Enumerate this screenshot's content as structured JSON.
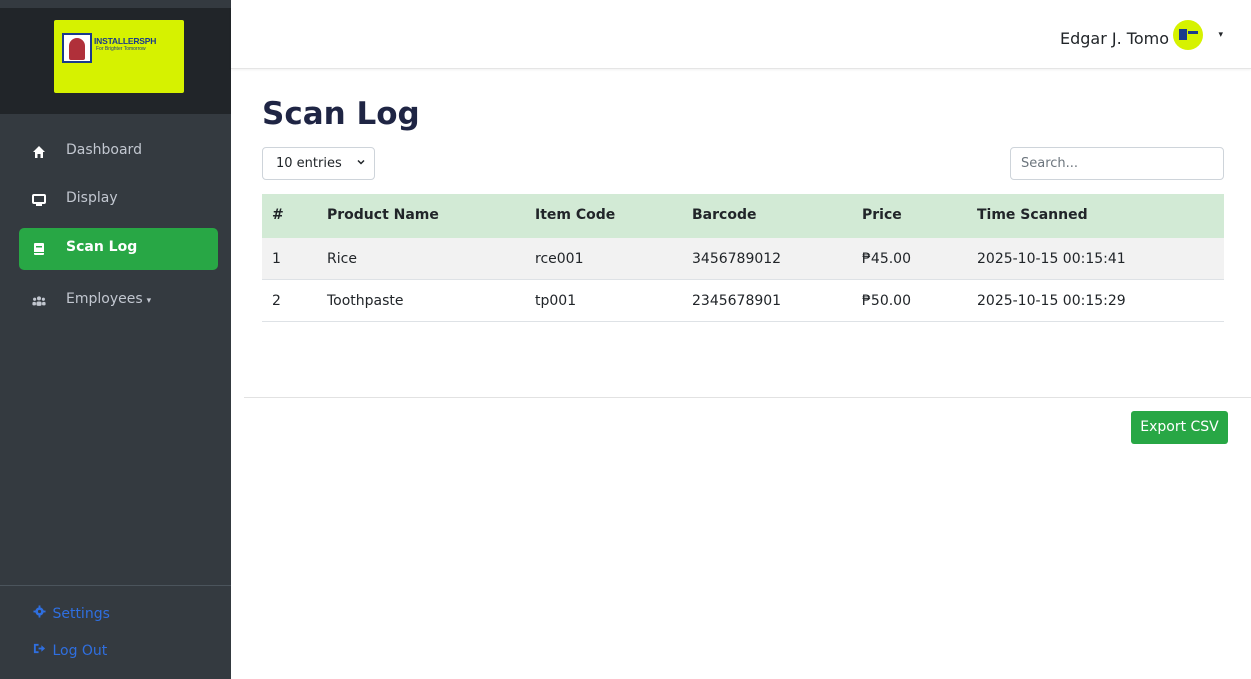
{
  "brand": {
    "logo_text": "INSTALLERSPH",
    "logo_tagline": "For Brighter Tomorrow"
  },
  "sidebar": {
    "items": [
      {
        "label": "Dashboard",
        "icon": "home-icon"
      },
      {
        "label": "Display",
        "icon": "monitor-icon"
      },
      {
        "label": "Scan Log",
        "icon": "book-icon",
        "active": true
      },
      {
        "label": "Employees",
        "icon": "users-icon",
        "caret": "▾"
      }
    ],
    "bottom": [
      {
        "label": "Settings",
        "icon": "gear-icon"
      },
      {
        "label": "Log Out",
        "icon": "logout-icon"
      }
    ]
  },
  "topbar": {
    "user_name": "Edgar J. Tomo",
    "caret": "▾"
  },
  "main": {
    "title": "Scan Log",
    "entries_label": "10 entries",
    "search_placeholder": "Search...",
    "export_label": "Export CSV"
  },
  "table": {
    "headers": [
      "#",
      "Product Name",
      "Item Code",
      "Barcode",
      "Price",
      "Time Scanned"
    ],
    "rows": [
      [
        "1",
        "Rice",
        "rce001",
        "3456789012",
        "₱45.00",
        "2025-10-15 00:15:41"
      ],
      [
        "2",
        "Toothpaste",
        "tp001",
        "2345678901",
        "₱50.00",
        "2025-10-15 00:15:29"
      ]
    ]
  },
  "colors": {
    "sidebar_bg": "#343a40",
    "accent_green": "#28a745",
    "header_row": "#d2ead5",
    "title": "#1f2544",
    "logo_bg": "#d6f200",
    "link_blue": "#2f6fe0"
  }
}
